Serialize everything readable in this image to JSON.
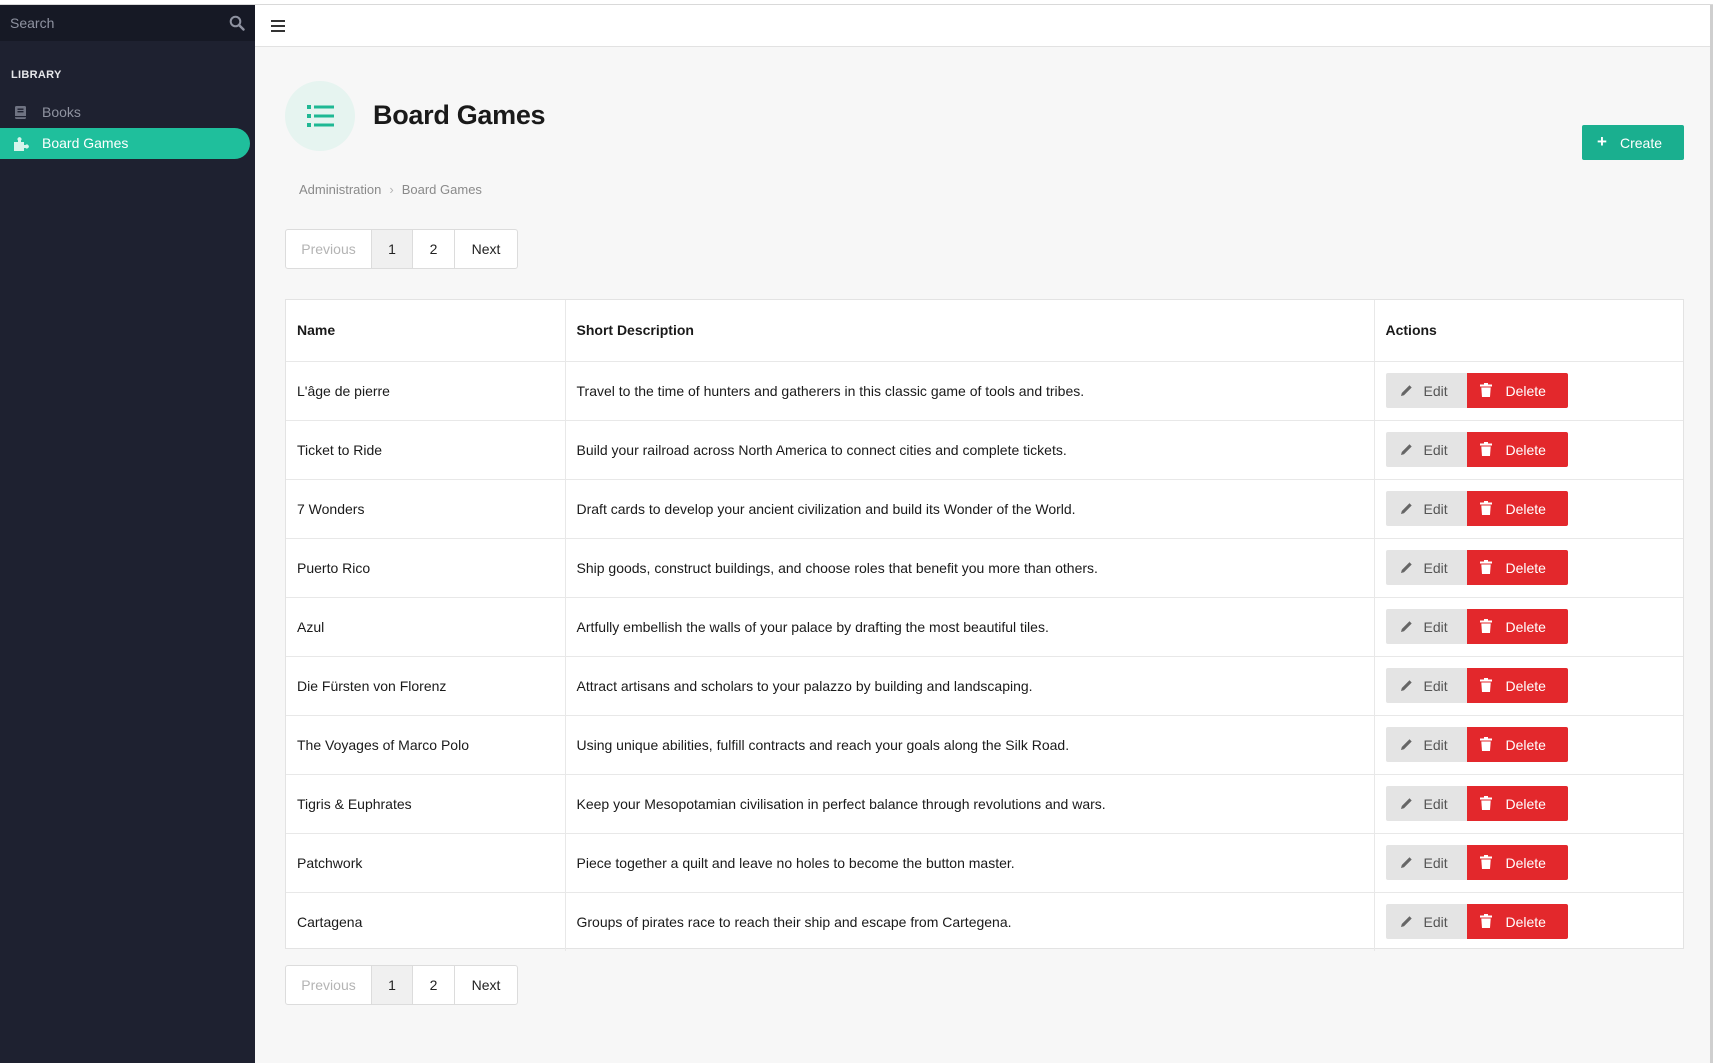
{
  "sidebar": {
    "search_placeholder": "Search",
    "section_title": "LIBRARY",
    "items": [
      {
        "label": "Books",
        "icon": "book-icon",
        "active": false
      },
      {
        "label": "Board Games",
        "icon": "puzzle-icon",
        "active": true
      }
    ],
    "accent_color": "#1fbf9c",
    "background_color": "#1e2130"
  },
  "header": {
    "title": "Board Games",
    "icon": "list-icon",
    "create_label": "Create"
  },
  "breadcrumb": [
    "Administration",
    "Board Games"
  ],
  "pagination": {
    "previous_label": "Previous",
    "pages": [
      "1",
      "2"
    ],
    "current_page": "1",
    "next_label": "Next"
  },
  "table": {
    "columns": [
      "Name",
      "Short Description",
      "Actions"
    ],
    "rows": [
      {
        "name": "L'âge de pierre",
        "description": "Travel to the time of hunters and gatherers in this classic game of tools and tribes."
      },
      {
        "name": "Ticket to Ride",
        "description": "Build your railroad across North America to connect cities and complete tickets."
      },
      {
        "name": "7 Wonders",
        "description": "Draft cards to develop your ancient civilization and build its Wonder of the World."
      },
      {
        "name": "Puerto Rico",
        "description": "Ship goods, construct buildings, and choose roles that benefit you more than others."
      },
      {
        "name": "Azul",
        "description": "Artfully embellish the walls of your palace by drafting the most beautiful tiles."
      },
      {
        "name": "Die Fürsten von Florenz",
        "description": "Attract artisans and scholars to your palazzo by building and landscaping."
      },
      {
        "name": "The Voyages of Marco Polo",
        "description": "Using unique abilities, fulfill contracts and reach your goals along the Silk Road."
      },
      {
        "name": "Tigris & Euphrates",
        "description": "Keep your Mesopotamian civilisation in perfect balance through revolutions and wars."
      },
      {
        "name": "Patchwork",
        "description": "Piece together a quilt and leave no holes to become the button master."
      },
      {
        "name": "Cartagena",
        "description": "Groups of pirates race to reach their ship and escape from Cartegena."
      }
    ],
    "edit_label": "Edit",
    "delete_label": "Delete",
    "delete_color": "#e3282c",
    "create_color": "#1aaf8f"
  }
}
